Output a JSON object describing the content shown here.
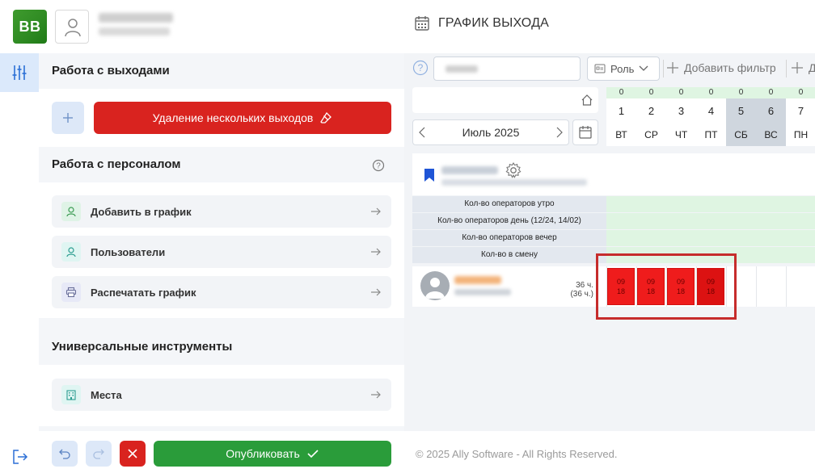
{
  "header": {
    "logo_text": "BB",
    "page_title": "ГРАФИК ВЫХОДА"
  },
  "panel": {
    "section_shifts": "Работа с выходами",
    "delete_button": "Удаление нескольких выходов",
    "section_staff": "Работа с персоналом",
    "staff_items": [
      {
        "label": "Добавить в график",
        "icon": "user-icon",
        "color": "#dff3e6"
      },
      {
        "label": "Пользователи",
        "icon": "user-icon",
        "color": "#dff5f2"
      },
      {
        "label": "Распечатать график",
        "icon": "printer-icon",
        "color": "#e7e9f7"
      }
    ],
    "section_tools": "Универсальные инструменты",
    "tools_items": [
      {
        "label": "Места",
        "icon": "building-icon",
        "color": "#dff5f2"
      }
    ]
  },
  "bottom": {
    "publish_label": "Опубликовать",
    "copyright": "© 2025 Ally Software - All Rights Reserved."
  },
  "filters": {
    "role_label": "Роль",
    "add_filter_label": "Добавить фильтр",
    "add_filter_cut": "Д"
  },
  "calendar": {
    "month_label": "Июль 2025",
    "days": [
      {
        "num": "1",
        "dow": "ВТ",
        "count": "0",
        "weekend": false
      },
      {
        "num": "2",
        "dow": "СР",
        "count": "0",
        "weekend": false
      },
      {
        "num": "3",
        "dow": "ЧТ",
        "count": "0",
        "weekend": false
      },
      {
        "num": "4",
        "dow": "ПТ",
        "count": "0",
        "weekend": false
      },
      {
        "num": "5",
        "dow": "СБ",
        "count": "0",
        "weekend": true
      },
      {
        "num": "6",
        "dow": "ВС",
        "count": "0",
        "weekend": true
      },
      {
        "num": "7",
        "dow": "ПН",
        "count": "0",
        "weekend": false
      }
    ],
    "stats": [
      "Кол-во операторов утро",
      "Кол-во операторов день (12/24, 14/02)",
      "Кол-во операторов вечер",
      "Кол-во в смену"
    ],
    "employee": {
      "hours": "36 ч.",
      "hours_sub": "(36 ч.)",
      "shifts": [
        {
          "start": "09",
          "end": "18"
        },
        {
          "start": "09",
          "end": "18"
        },
        {
          "start": "09",
          "end": "18"
        },
        {
          "start": "09",
          "end": "18"
        }
      ]
    }
  },
  "colors": {
    "danger": "#d9231f",
    "success": "#2a9c3a",
    "shift": "#ef1c1c",
    "accent_light": "#dde8f8"
  }
}
